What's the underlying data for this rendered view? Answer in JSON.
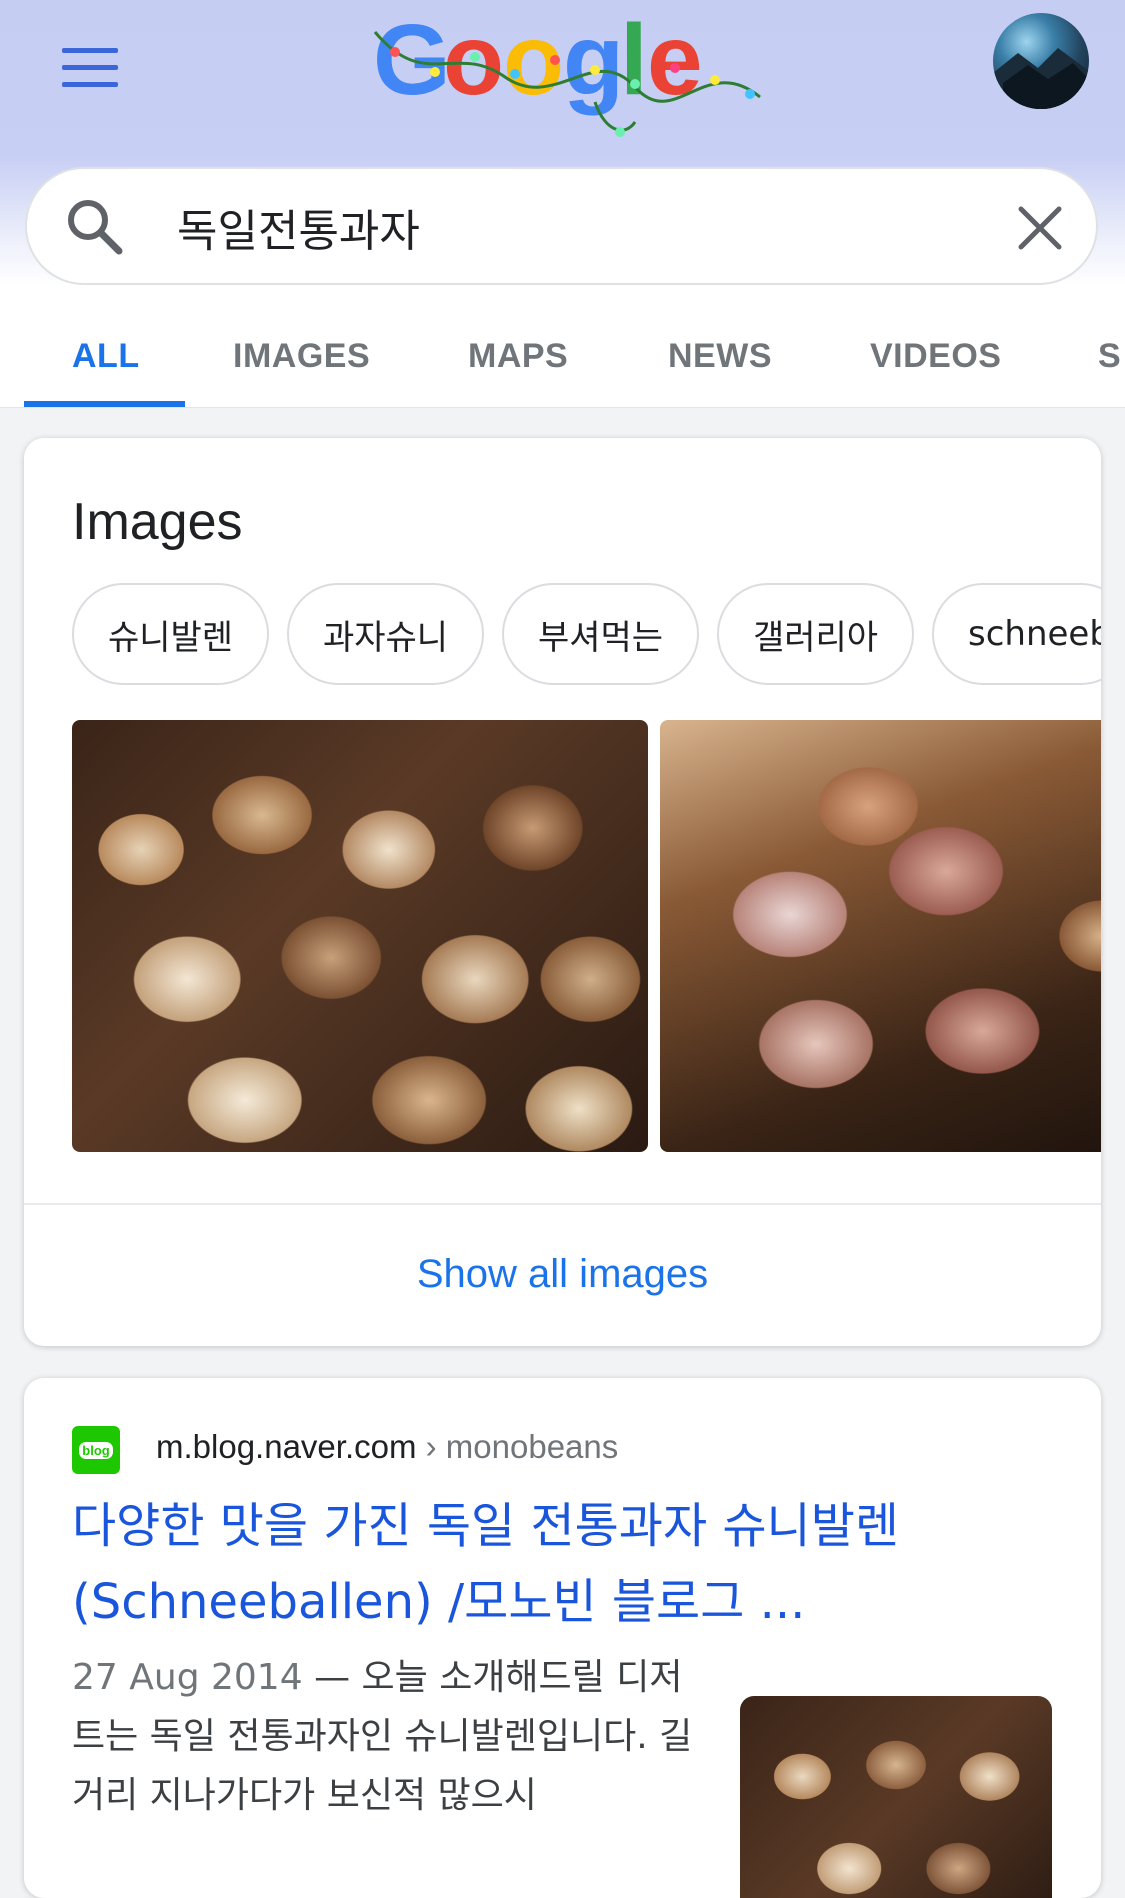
{
  "header": {
    "logo_text": "Google",
    "search": {
      "value": "독일전통과자",
      "placeholder": ""
    }
  },
  "tabs": [
    {
      "label": "ALL",
      "active": true
    },
    {
      "label": "IMAGES"
    },
    {
      "label": "MAPS"
    },
    {
      "label": "NEWS"
    },
    {
      "label": "VIDEOS"
    },
    {
      "label": "S"
    }
  ],
  "images_card": {
    "title": "Images",
    "chips": [
      "슈니발렌",
      "과자슈니",
      "부셔먹는",
      "갤러리아",
      "schneeb"
    ],
    "show_all": "Show all images"
  },
  "result": {
    "favicon_text": "blog",
    "url": "m.blog.naver.com",
    "breadcrumb": "› monobeans",
    "title": "다양한 맛을 가진 독일 전통과자 슈니발렌 (Schneeballen) /모노빈 블로그 ...",
    "date": "27 Aug 2014",
    "snippet": "— 오늘 소개해드릴 디저트는 독일 전통과자인 슈니발렌입니다. 길거리 지나가다가 보신적 많으시"
  },
  "colors": {
    "accent": "#1a73e8",
    "header_bg": "#c5cdf3",
    "link": "#1a56db"
  }
}
